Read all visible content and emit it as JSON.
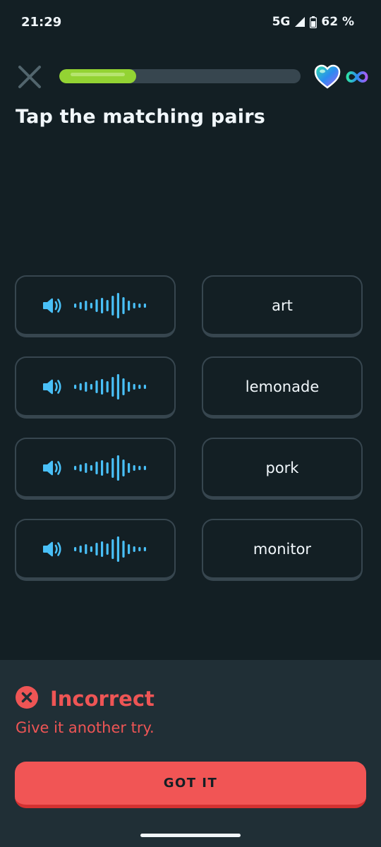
{
  "status_bar": {
    "time": "21:29",
    "network": "5G",
    "battery": "62 %"
  },
  "header": {
    "close_icon": "close-icon",
    "progress": 0.32,
    "hearts_icon": "heart-icon",
    "hearts_count_icon": "infinity-icon"
  },
  "prompt": {
    "title": "Tap the matching pairs"
  },
  "audio_tiles": [
    {
      "icon": "speaker-icon",
      "waveform": "waveform-icon"
    },
    {
      "icon": "speaker-icon",
      "waveform": "waveform-icon"
    },
    {
      "icon": "speaker-icon",
      "waveform": "waveform-icon"
    },
    {
      "icon": "speaker-icon",
      "waveform": "waveform-icon"
    }
  ],
  "word_tiles": [
    {
      "label": "art"
    },
    {
      "label": "lemonade"
    },
    {
      "label": "pork"
    },
    {
      "label": "monitor"
    }
  ],
  "feedback": {
    "icon": "x-circle-icon",
    "title": "Incorrect",
    "message": "Give it another try.",
    "button_label": "GOT IT"
  },
  "colors": {
    "background": "#131f24",
    "accent_blue": "#49c0f8",
    "progress_green": "#93d333",
    "error_red": "#ee5555",
    "button_red": "#f15555"
  }
}
